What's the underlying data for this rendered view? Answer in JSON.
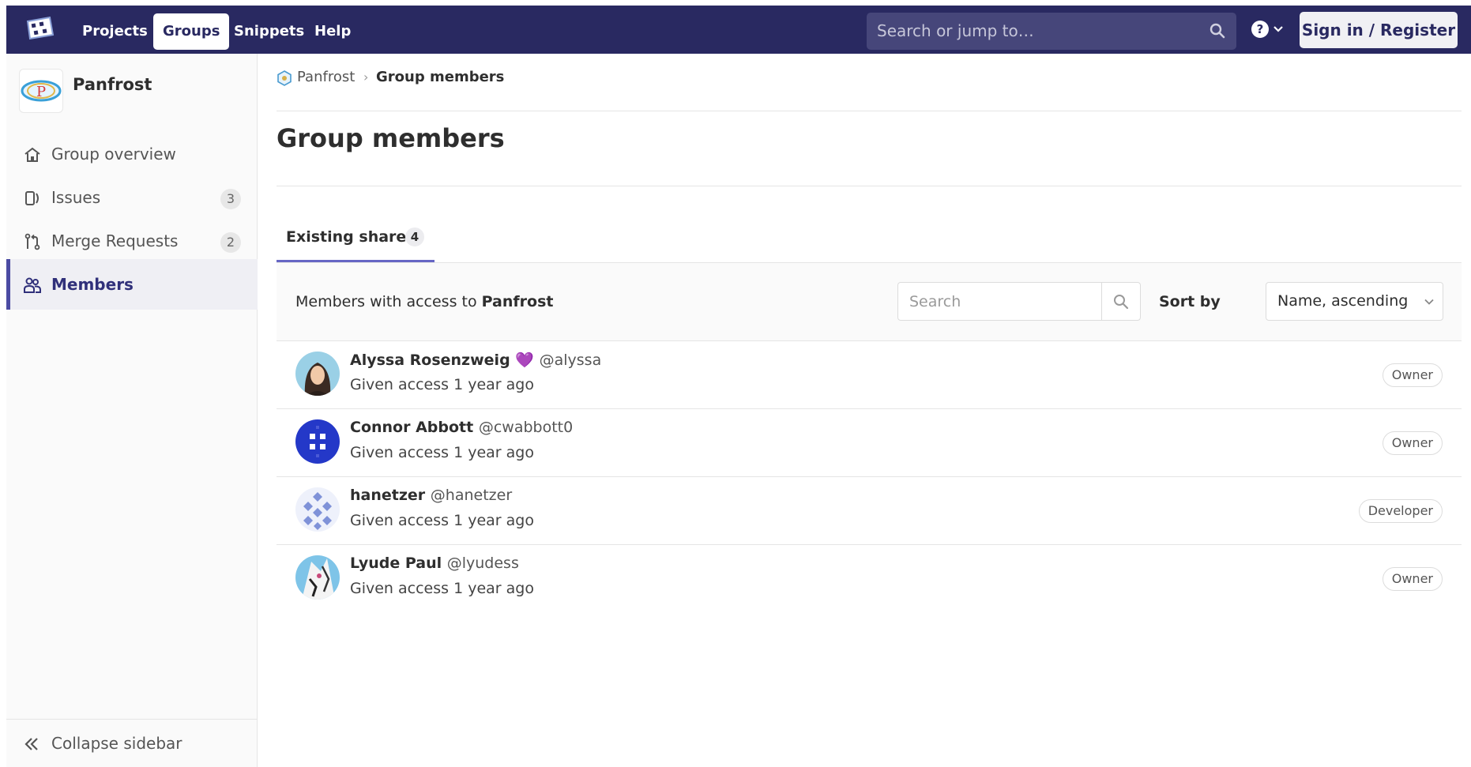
{
  "topbar": {
    "nav": [
      "Projects",
      "Groups",
      "Snippets",
      "Help"
    ],
    "search_placeholder": "Search or jump to…",
    "signin": "Sign in / Register"
  },
  "sidebar": {
    "group_name": "Panfrost",
    "group_avatar_letter": "P",
    "items": [
      {
        "label": "Group overview",
        "icon": "home-icon"
      },
      {
        "label": "Issues",
        "icon": "issues-icon",
        "count": "3"
      },
      {
        "label": "Merge Requests",
        "icon": "merge-request-icon",
        "count": "2"
      },
      {
        "label": "Members",
        "icon": "users-icon",
        "active": true
      }
    ],
    "collapse": "Collapse sidebar"
  },
  "breadcrumb": {
    "group": "Panfrost",
    "current": "Group members"
  },
  "page_title": "Group members",
  "tab": {
    "label": "Existing shares",
    "count": "4"
  },
  "panel": {
    "prefix": "Members with access to",
    "group": "Panfrost",
    "search_placeholder": "Search",
    "sort_label": "Sort by",
    "sort_value": "Name, ascending"
  },
  "members": [
    {
      "name": "Alyssa Rosenzweig",
      "emoji": "💜",
      "username": "@alyssa",
      "since": "Given access 1 year ago",
      "role": "Owner"
    },
    {
      "name": "Connor Abbott",
      "username": "@cwabbott0",
      "since": "Given access 1 year ago",
      "role": "Owner"
    },
    {
      "name": "hanetzer",
      "username": "@hanetzer",
      "since": "Given access 1 year ago",
      "role": "Developer"
    },
    {
      "name": "Lyude Paul",
      "username": "@lyudess",
      "since": "Given access 1 year ago",
      "role": "Owner"
    }
  ],
  "colors": {
    "topbar": "#292961",
    "accent": "#4b4ba3",
    "heart": "#8a2bb8"
  }
}
